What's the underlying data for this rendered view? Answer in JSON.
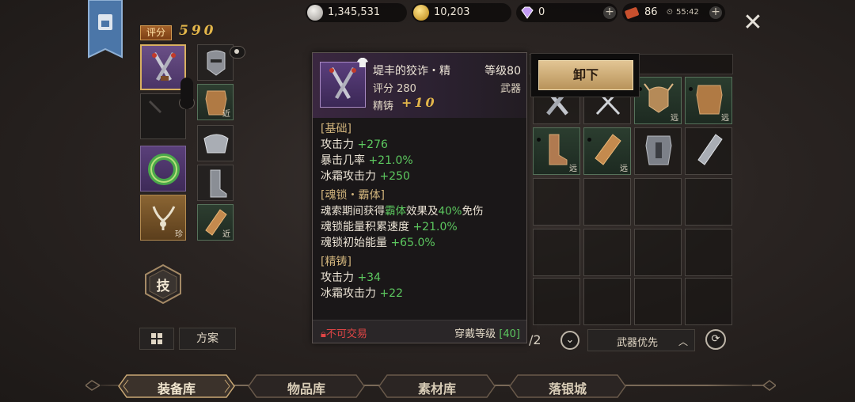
{
  "currencies": [
    {
      "name": "silver",
      "value": "1,345,531",
      "color": "#c9c6c1"
    },
    {
      "name": "gold",
      "value": "10,203",
      "color": "#e2b13a"
    },
    {
      "name": "diamond",
      "value": "0",
      "color": "#b88cf2"
    },
    {
      "name": "ticket",
      "value": "86",
      "color": "#c8502e"
    }
  ],
  "ticket_timer": "55:42",
  "score": {
    "label": "评分",
    "value": "590"
  },
  "equipment": {
    "near_label": "近",
    "rare_label": "珍"
  },
  "skill_label": "技",
  "plan_button": "方案",
  "inventory": {
    "far_label": "远",
    "page": "/2",
    "sort_label": "武器优先"
  },
  "tooltip": {
    "name": "堤丰的狡诈・精",
    "level": "等级80",
    "score": "评分 280",
    "type": "武器",
    "forge_label": "精铸",
    "forge_value": "+10",
    "sections": [
      {
        "title": "[基础]",
        "lines": [
          {
            "text": "攻击力 ",
            "green": "+276"
          },
          {
            "text": "暴击几率 ",
            "green": "+21.0%"
          },
          {
            "text": "冰霜攻击力 ",
            "green": "+250"
          }
        ]
      },
      {
        "title": "[魂锁・霸体]",
        "lines": [
          {
            "text": "魂索期间获得",
            "green": "霸体",
            "text2": "效果及",
            "green2": "40%",
            "text3": "免伤"
          },
          {
            "text": "魂锁能量积累速度 ",
            "green": "+21.0%"
          },
          {
            "text": "魂锁初始能量 ",
            "green": "+65.0%"
          }
        ]
      },
      {
        "title": "[精铸]",
        "lines": [
          {
            "text": "攻击力 ",
            "green": "+34"
          },
          {
            "text": "冰霜攻击力 ",
            "green": "+22"
          }
        ]
      }
    ],
    "tradable": "不可交易",
    "wear_label": "穿戴等级",
    "wear_level": "[40]"
  },
  "unequip_button": "卸下",
  "tabs": [
    "装备库",
    "物品库",
    "素材库",
    "落银城"
  ],
  "active_tab": "装备库"
}
